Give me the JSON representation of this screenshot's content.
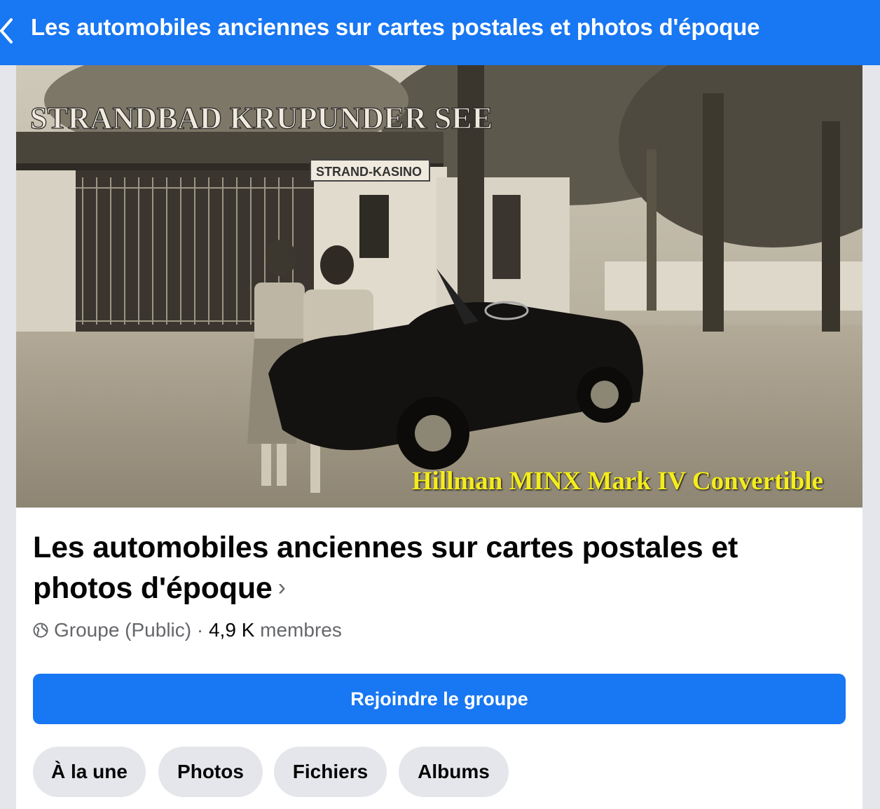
{
  "header": {
    "title": "Les automobiles anciennes sur cartes postales et photos d'époque",
    "back_icon": "chevron-left-icon"
  },
  "cover": {
    "caption": "Hillman MINX Mark IV Convertible",
    "sign_main": "STRANDBAD KRUPUNDER SEE",
    "sign_kasino": "STRAND-KASINO"
  },
  "group": {
    "name": "Les automobiles anciennes sur cartes postales et photos d'époque",
    "privacy": "Groupe (Public)",
    "separator": "·",
    "member_count": "4,9 K",
    "members_label": "membres"
  },
  "join_button": {
    "label": "Rejoindre le groupe"
  },
  "tabs": [
    {
      "label": "À la une"
    },
    {
      "label": "Photos"
    },
    {
      "label": "Fichiers"
    },
    {
      "label": "Albums"
    }
  ],
  "colors": {
    "brand": "#1877f2",
    "tab_bg": "#e4e6eb",
    "caption_yellow": "#f4ec1c"
  }
}
